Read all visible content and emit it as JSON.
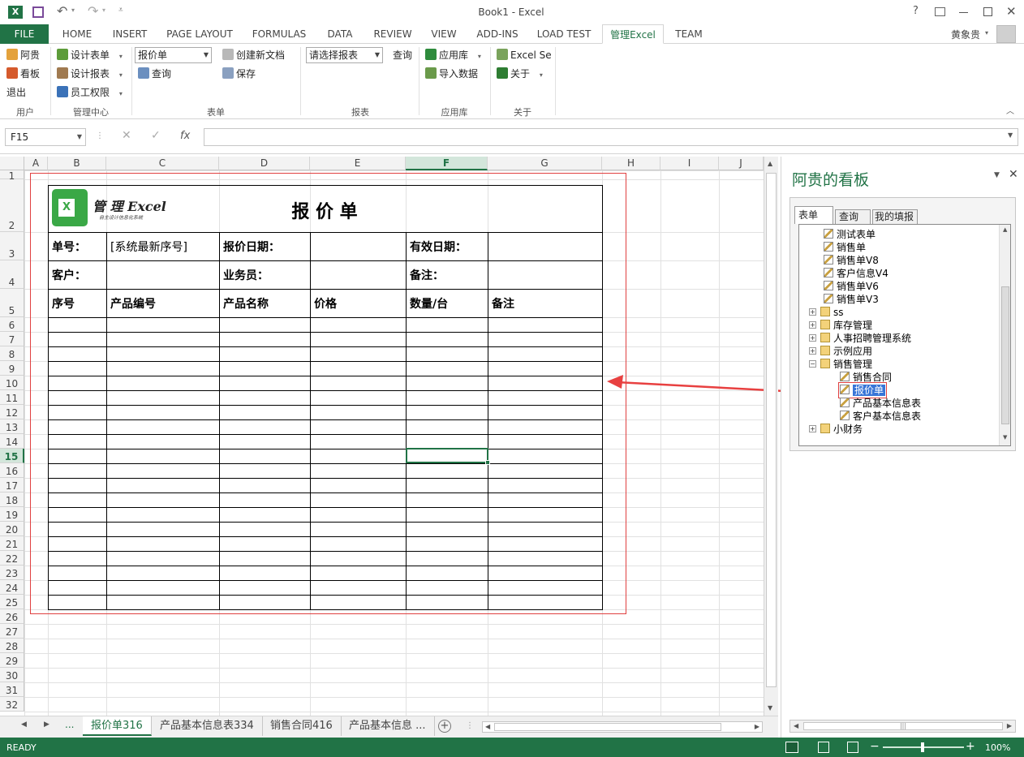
{
  "window": {
    "title": "Book1 - Excel",
    "help": "?",
    "user": "黄象贵"
  },
  "tabs": [
    "FILE",
    "HOME",
    "INSERT",
    "PAGE LAYOUT",
    "FORMULAS",
    "DATA",
    "REVIEW",
    "VIEW",
    "ADD-INS",
    "LOAD TEST",
    "管理Excel",
    "TEAM"
  ],
  "ribbon": {
    "user_group": {
      "label": "用户",
      "items": [
        "阿贵",
        "看板",
        "退出"
      ]
    },
    "mgmt_group": {
      "label": "管理中心",
      "items": [
        "设计表单",
        "设计报表",
        "员工权限"
      ]
    },
    "form_group": {
      "label": "表单",
      "combo": "报价单",
      "query": "查询",
      "create": "创建新文档",
      "save": "保存"
    },
    "report_group": {
      "label": "报表",
      "combo": "请选择报表",
      "query": "查询"
    },
    "app_group": {
      "label": "应用库",
      "items": [
        "应用库",
        "导入数据"
      ]
    },
    "about_group": {
      "label": "关于",
      "items": [
        "Excel Se",
        "关于"
      ]
    }
  },
  "formula": {
    "namebox": "F15",
    "fx": "fx",
    "value": ""
  },
  "columns": [
    "A",
    "B",
    "C",
    "D",
    "E",
    "F",
    "G",
    "H",
    "I",
    "J"
  ],
  "rows": [
    "1",
    "2",
    "3",
    "4",
    "5",
    "6",
    "7",
    "8",
    "9",
    "10",
    "11",
    "12",
    "13",
    "14",
    "15",
    "16",
    "17",
    "18",
    "19",
    "20",
    "21",
    "22",
    "23",
    "24",
    "25",
    "26",
    "27",
    "28",
    "29",
    "30",
    "31",
    "32"
  ],
  "sheet": {
    "logo_title": "管 理 Excel",
    "logo_sub": "自主设计信息化系统",
    "logo_x": "X",
    "title": "报 价 单",
    "labels": {
      "order_no": "单号：",
      "order_val": "[系统最新序号]",
      "quote_date": "报价日期：",
      "valid_date": "有效日期：",
      "customer": "客户：",
      "salesman": "业务员：",
      "remark": "备注："
    },
    "headers": [
      "序号",
      "产品编号",
      "产品名称",
      "价格",
      "数量/台",
      "备注"
    ]
  },
  "pane": {
    "title": "阿贵的看板",
    "tabs": [
      "表单",
      "查询",
      "我的填报"
    ],
    "tree": [
      {
        "label": "测试表单",
        "type": "form",
        "level": 1
      },
      {
        "label": "销售单",
        "type": "form",
        "level": 1
      },
      {
        "label": "销售单V8",
        "type": "form",
        "level": 1
      },
      {
        "label": "客户信息V4",
        "type": "form",
        "level": 1
      },
      {
        "label": "销售单V6",
        "type": "form",
        "level": 1
      },
      {
        "label": "销售单V3",
        "type": "form",
        "level": 1
      },
      {
        "label": "ss",
        "type": "folder",
        "level": 0
      },
      {
        "label": "库存管理",
        "type": "folder",
        "level": 0
      },
      {
        "label": "人事招聘管理系统",
        "type": "folder",
        "level": 0
      },
      {
        "label": "示例应用",
        "type": "folder",
        "level": 0
      },
      {
        "label": "销售管理",
        "type": "folder-open",
        "level": 0
      },
      {
        "label": "销售合同",
        "type": "form",
        "level": 2
      },
      {
        "label": "报价单",
        "type": "form-selected",
        "level": 2
      },
      {
        "label": "产品基本信息表",
        "type": "form",
        "level": 2
      },
      {
        "label": "客户基本信息表",
        "type": "form",
        "level": 2
      },
      {
        "label": "小财务",
        "type": "folder",
        "level": 0
      }
    ]
  },
  "sheet_tabs": [
    "报价单316",
    "产品基本信息表334",
    "销售合同416",
    "产品基本信息 ..."
  ],
  "status": {
    "ready": "READY",
    "zoom": "100%"
  },
  "colors": {
    "accent": "#217346",
    "print_border": "#e04040",
    "arrow": "#e84040"
  }
}
